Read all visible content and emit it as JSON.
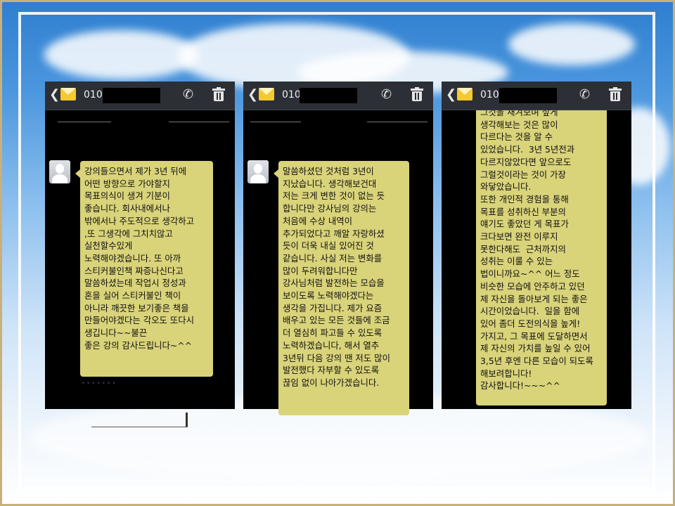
{
  "colors": {
    "bubble": "#d9d37a",
    "phone_bg": "#000000",
    "bar_bg": "#2c2f36"
  },
  "phones": [
    {
      "number_prefix": "010-",
      "icons": [
        "back-icon",
        "envelope-icon",
        "call-icon",
        "trash-icon"
      ],
      "message": "강의들으면서 제가 3년 뒤에\n어떤 방향으로 가야할지\n목표의식이 생겨 기분이\n좋습니다. 회사내에서나\n밖에서나 주도적으로 생각하고\n,또 그생각에 그치치않고\n실천할수있게\n노력해야겠습니다. 또 아까\n스티커불인책 짜증나신다고\n말씀하셨는데 작업시 정성과\n혼을 실어 스티커불인 책이\n아니라 깨끗한 보기좋은 책을\n만들어야겠다는 각오도 또다시\n생깁니다~~불끈\n좋은 강의 감사드립니다~^^"
    },
    {
      "number_prefix": "010",
      "icons": [
        "back-icon",
        "envelope-icon",
        "call-icon",
        "trash-icon"
      ],
      "message": "말씀하셨던 것처럼 3년이\n지났습니다. 생각해보건대\n저는 크게 변한 것이 없는 듯\n합니다만 강사님의 강의는\n처음에 수상 내역이\n추가되었다고 깨알 자랑하셨\n듯이 더욱 내실 있어진 것\n같습니다. 사실 저는 변화를\n많이 두려워합니다만\n강사님처럼 발전하는 모습을\n보이도록 노력해야겠다는\n생각을 가집니다. 제가 요즘\n배우고 있는 모든 것들에 조금\n더 열심히 파고들 수 있도록\n노력하겠습니다, 해서 열추\n3년뒤 다음 강의 땐 저도 많이\n발전했다 자부할 수 있도록\n끊임 없이 나아가겠습니다."
    },
    {
      "number_prefix": "010-",
      "icons": [
        "back-icon",
        "envelope-icon",
        "call-icon",
        "trash-icon"
      ],
      "message": "그것을 새겨보며 싶게\n생각해보는 것은 많이\n다르다는 것을 알 수\n있었습니다.  3년 5년전과\n다르지않았다면 앞으로도\n그럴것이라는 것이 가장\n와닿았습니다.\n또한 개인적 경험을 통해\n목표를 성취하신 부분의\n얘기도 좋았던 게 목표가\n크다보면 완전 이루지\n못한다해도  근처까지의\n성취는 이룰 수 있는\n법이니까요~^^ 어느 정도\n비슷한 모습에 안주하고 있던\n제 자신을 돌아보게 되는 좋은\n시간이었습니다.  일을 함에\n있어 좀더 도전의식을 높게!\n가지고, 그 목표에 도달하면서\n제 자신의 가치를 높일 수 있어\n3,5년 후엔 다른 모습이 되도록\n해보려합니다!\n감사합니다!~~~^^"
    }
  ]
}
